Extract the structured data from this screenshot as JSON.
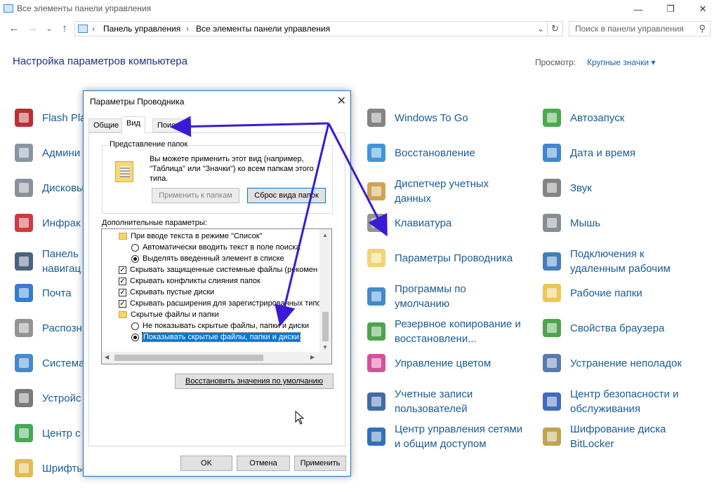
{
  "window": {
    "title": "Все элементы панели управления",
    "minimize": "—",
    "restore": "❐",
    "close": "✕"
  },
  "nav": {
    "back": "←",
    "forward": "→",
    "recent": "⌄",
    "up": "↑",
    "crumb_sep": "›",
    "breadcrumbs": [
      "Панель управления",
      "Все элементы панели управления"
    ],
    "dropdown": "⌄",
    "refresh": "↻",
    "search_placeholder": "Поиск в панели управления",
    "search_icon": "⚲"
  },
  "header": {
    "title": "Настройка параметров компьютера",
    "view_label": "Просмотр:",
    "view_value": "Крупные значки ▾"
  },
  "items_col1": [
    {
      "label": "Flash Pla",
      "icon": "flash-icon"
    },
    {
      "label": "Админи",
      "icon": "admin-tools-icon"
    },
    {
      "label": "Дисковы",
      "icon": "storage-icon"
    },
    {
      "label": "Инфрак",
      "icon": "infrared-icon"
    },
    {
      "label": "Панель\nнавигац",
      "icon": "taskbar-icon"
    },
    {
      "label": "Почта",
      "icon": "mail-icon"
    },
    {
      "label": "Распозн",
      "icon": "speech-icon"
    },
    {
      "label": "Система",
      "icon": "system-icon"
    },
    {
      "label": "Устройс",
      "icon": "devices-icon"
    },
    {
      "label": "Центр с",
      "icon": "sync-icon"
    },
    {
      "label": "Шрифты",
      "icon": "fonts-icon"
    }
  ],
  "items_col2": [
    {
      "label": "Windows To Go",
      "icon": "usb-drive-icon"
    },
    {
      "label": "Восстановление",
      "icon": "recovery-icon"
    },
    {
      "label": "Диспетчер учетных\nданных",
      "icon": "credential-icon"
    },
    {
      "label": "Клавиатура",
      "icon": "keyboard-icon"
    },
    {
      "label": "Параметры Проводника",
      "icon": "folder-options-icon"
    },
    {
      "label": "Программы по\nумолчанию",
      "icon": "default-programs-icon"
    },
    {
      "label": "Резервное копирование и\nвосстановлени...",
      "icon": "backup-icon"
    },
    {
      "label": "Управление цветом",
      "icon": "color-icon"
    },
    {
      "label": "Учетные записи\nпользователей",
      "icon": "users-icon"
    },
    {
      "label": "Центр управления сетями\nи общим доступом",
      "icon": "network-icon"
    }
  ],
  "items_col3": [
    {
      "label": "Автозапуск",
      "icon": "autoplay-icon"
    },
    {
      "label": "Дата и время",
      "icon": "datetime-icon"
    },
    {
      "label": "Звук",
      "icon": "sound-icon"
    },
    {
      "label": "Мышь",
      "icon": "mouse-icon"
    },
    {
      "label": "Подключения к\nудаленным рабочим",
      "icon": "remote-icon"
    },
    {
      "label": "Рабочие папки",
      "icon": "work-folders-icon"
    },
    {
      "label": "Свойства браузера",
      "icon": "browser-icon"
    },
    {
      "label": "Устранение неполадок",
      "icon": "troubleshoot-icon"
    },
    {
      "label": "Центр безопасности и\nобслуживания",
      "icon": "security-icon"
    },
    {
      "label": "Шифрование диска\nBitLocker",
      "icon": "bitlocker-icon"
    }
  ],
  "dialog": {
    "title": "Параметры Проводника",
    "close": "✕",
    "tabs": [
      "Общие",
      "Вид",
      "Поиск"
    ],
    "folder_views_legend": "Представление папок",
    "folder_views_text": "Вы можете применить этот вид (например, \"Таблица\" или \"Значки\") ко всем папкам этого типа.",
    "apply_to_folders": "Применить к папкам",
    "reset_folders": "Сброс вида папок",
    "advanced_label": "Дополнительные параметры:",
    "tree": [
      {
        "type": "folder",
        "indent": 0,
        "label": "При вводе текста в режиме \"Список\""
      },
      {
        "type": "radio",
        "checked": false,
        "indent": 1,
        "label": "Автоматически вводить текст в поле поиска"
      },
      {
        "type": "radio",
        "checked": true,
        "indent": 1,
        "label": "Выделять введенный элемент в списке"
      },
      {
        "type": "check",
        "checked": true,
        "indent": 0,
        "label": "Скрывать защищенные системные файлы (рекомен"
      },
      {
        "type": "check",
        "checked": true,
        "indent": 0,
        "label": "Скрывать конфликты слияния папок"
      },
      {
        "type": "check",
        "checked": true,
        "indent": 0,
        "label": "Скрывать пустые диски"
      },
      {
        "type": "check",
        "checked": true,
        "indent": 0,
        "label": "Скрывать расширения для зарегистрированных типо"
      },
      {
        "type": "folder",
        "indent": 0,
        "label": "Скрытые файлы и папки"
      },
      {
        "type": "radio",
        "checked": false,
        "indent": 1,
        "label": "Не показывать скрытые файлы, папки и диски"
      },
      {
        "type": "radio",
        "checked": true,
        "indent": 1,
        "selected": true,
        "label": "Показывать скрытые файлы, папки и диски"
      }
    ],
    "restore_defaults": "Восстановить значения по умолчанию",
    "ok": "OK",
    "cancel": "Отмена",
    "apply": "Применить"
  },
  "colors": {
    "accent": "#0078d7",
    "link": "#1a5c96",
    "annotation": "#3a1ad6"
  }
}
